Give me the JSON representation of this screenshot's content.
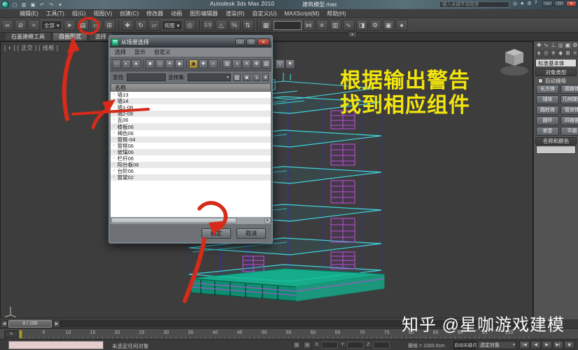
{
  "app": {
    "title": "Autodesk 3ds Max 2010",
    "doc": "建筑模型.max",
    "search_placeholder": "键入关键字或短语"
  },
  "menubar": {
    "items": [
      "编辑(E)",
      "工具(T)",
      "组(G)",
      "视图(V)",
      "创建(C)",
      "修改器",
      "动画",
      "图形编辑器",
      "渲染(R)",
      "自定义(U)",
      "MAXScript(M)",
      "帮助(H)"
    ]
  },
  "toolbar": {
    "filter": "全部",
    "coord": "视图",
    "snap": "2.5"
  },
  "ribbon": {
    "tabs": [
      "石墨建模工具",
      "自由形式",
      "选择"
    ]
  },
  "viewport": {
    "label": "[ + ] [ 正交 ] [ 线框 ]"
  },
  "dialog": {
    "title": "从场景选择",
    "menus": [
      "选择",
      "显示",
      "自定义"
    ],
    "find_label": "查找:",
    "set_label": "选择集:",
    "name_header": "名称",
    "items": [
      "墙13",
      "墙14",
      "墙1-08",
      "墙2-08",
      "瓦06",
      "楼板06",
      "褐色06",
      "窗框-04",
      "窗框06",
      "玻璃06",
      "栏杆06",
      "阳台板06",
      "台阶06",
      "窗架02"
    ],
    "ok": "确定",
    "cancel": "取消"
  },
  "annotation": {
    "line1": "根据输出警告",
    "line2": "找到相应组件",
    "color": "#f2e50c"
  },
  "panel": {
    "dropdown": "标准基本体",
    "rollout1": "对象类型",
    "autogrid": "自动栅格",
    "button_rows": [
      {
        "l": "长方体",
        "r": "圆锥体"
      },
      {
        "l": "球体",
        "r": "几何球体"
      },
      {
        "l": "圆柱体",
        "r": "管状体"
      },
      {
        "l": "圆环",
        "r": "四棱锥"
      },
      {
        "l": "茶壶",
        "r": "平面"
      }
    ],
    "rollout2": "名称和颜色"
  },
  "timeline": {
    "frame": "0 / 100",
    "ticks": [
      "5",
      "10",
      "15",
      "20",
      "25",
      "30",
      "35",
      "40",
      "45",
      "50",
      "55",
      "60",
      "65",
      "70",
      "75",
      "80",
      "85",
      "90",
      "95",
      "100"
    ]
  },
  "status": {
    "message": "未选定任何对象",
    "x": "X:",
    "y": "Y:",
    "z": "Z:",
    "grid": "栅格 = 1000.0cm",
    "autokey": "自动关键点",
    "selset": "选定对象"
  },
  "watermark": "知乎 @星咖游戏建模",
  "colors": {
    "annotation_red": "#d62b1a",
    "wire_cyan": "#3fd6de",
    "wire_purple": "#b44fd0",
    "wire_blue": "#2d2db8"
  },
  "icons": {
    "caret": "▾",
    "minimize": "—",
    "maximize": "□",
    "close": "✕",
    "new_scene": "▢",
    "open_file": "▥",
    "save_file": "▣",
    "undo": "↶",
    "redo": "↷",
    "search_compass": "◎",
    "search_gear": "⚙",
    "search_star": "★",
    "search_help": "?",
    "select_link": "∞",
    "unlink": "⊘",
    "bind_spacewarp": "≈",
    "select_object": "➤",
    "select_by_name": "▤",
    "rect_region": "▭",
    "window_crossing": "⊞",
    "select_move": "✚",
    "select_rotate": "↻",
    "select_scale": "▱",
    "use_center": "◎",
    "angle_snap": "△",
    "percent_snap": "%",
    "spinner_snap": "⇅",
    "edit_named": "▦",
    "mirror": "⋈",
    "align": "≡",
    "layer_manager": "▥",
    "curve_editor": "∿",
    "material_editor": "◨",
    "render_setup": "⚙",
    "render_frame": "▣",
    "render": "●",
    "radio": "○",
    "d_none": "○",
    "d_invert": "◐",
    "d_all": "●",
    "d_geometry": "■",
    "d_shapes": "◇",
    "d_lights": "☀",
    "d_cameras": "◆",
    "d_helpers": "✚",
    "d_spacewarps": "≈",
    "d_groups": "▣",
    "d_xrefs": "▥",
    "d_materials": "◑",
    "d_bones": "✕",
    "d_frozen": "✻",
    "d_hidden": "▨",
    "d_filter1": "▽",
    "d_filter2": "▼",
    "t_create": "✚",
    "t_modify": "∿",
    "t_hierarchy": "⊥",
    "t_motion": "◎",
    "t_display": "▣",
    "t_utilities": "⚙",
    "c_geometry": "●",
    "c_shapes": "◇",
    "c_lights": "☀",
    "c_cameras": "◆",
    "c_helpers": "⊞",
    "c_spacewarps": "≈",
    "c_systems": "∗",
    "rollout_minus": "-",
    "lock": "⊠",
    "absmode": "⊞",
    "trackbar_menu": "≡",
    "pb_prev_key": "|◀",
    "pb_prev": "◀",
    "pb_play": "▶",
    "pb_next": "▶|",
    "pb_key": "◉",
    "scroll_right": "▸"
  }
}
